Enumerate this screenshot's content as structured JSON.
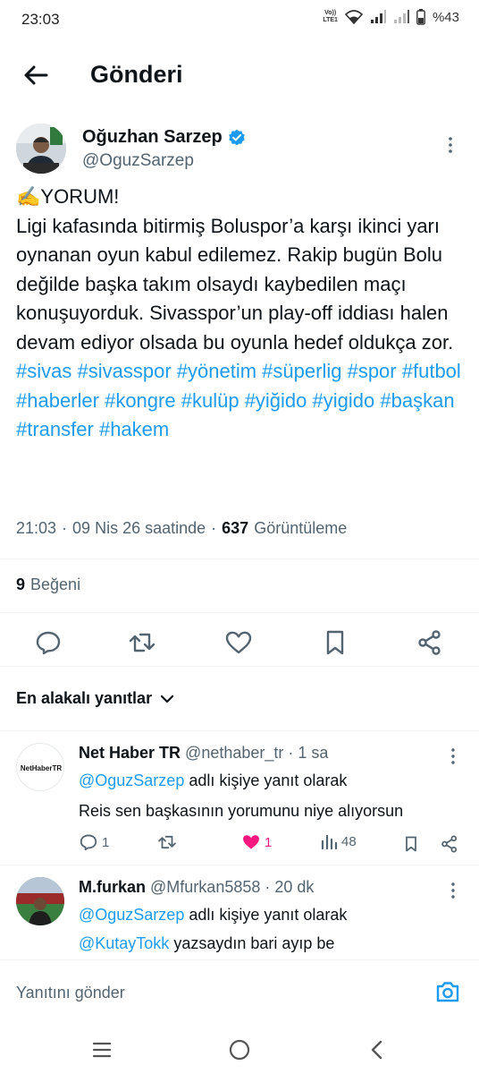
{
  "status_bar": {
    "time": "23:03",
    "volte": "Vo))\nLTE1",
    "battery": "%43"
  },
  "header": {
    "title": "Gönderi"
  },
  "tweet": {
    "author_name": "Oğuzhan Sarzep",
    "author_handle": "@OguzSarzep",
    "text_prefix": "✍️YORUM!\nLigi kafasında bitirmiş Boluspor’a karşı ikinci yarı oynanan oyun kabul edilemez. Rakip bugün Bolu değilde başka takım olsaydı kaybedilen maçı konuşuyorduk. Sivasspor’un play-off iddiası halen devam ediyor olsada bu oyunla hedef oldukça zor.",
    "hashtags": [
      "#sivas",
      "#sivasspor",
      "#yönetim",
      "#süperlig",
      "#spor",
      "#futbol",
      "#haberler",
      "#kongre",
      "#kulüp",
      "#yiğido",
      "#yigido",
      "#başkan",
      "#transfer",
      "#hakem"
    ],
    "time": "21:03",
    "date": "09 Nis 26 saatinde",
    "views_count": "637",
    "views_label": "Görüntüleme",
    "likes_count": "9",
    "likes_label": "Beğeni"
  },
  "sort_label": "En alakalı yanıtlar",
  "replies": [
    {
      "name": "Net Haber TR",
      "handle": "@nethaber_tr",
      "time": "· 1 sa",
      "avatar_text": "NetHaberTR",
      "reply_to_mention": "@OguzSarzep",
      "reply_to_suffix": "adlı kişiye yanıt olarak",
      "text": "Reis sen başkasının yorumunu niye alıyorsun",
      "replies_count": "1",
      "retweets_count": "",
      "likes_count": "1",
      "views_count": "48"
    },
    {
      "name": "M.furkan",
      "handle": "@Mfurkan5858",
      "time": "· 20 dk",
      "reply_to_mention": "@OguzSarzep",
      "reply_to_suffix": "adlı kişiye yanıt olarak",
      "text_mention": "@KutayTokk",
      "text": "yazsaydın bari ayıp be"
    }
  ],
  "composer": {
    "placeholder": "Yanıtını gönder"
  },
  "colors": {
    "accent": "#1d9bf0",
    "like_active": "#f91880",
    "text": "#0f1419",
    "muted": "#536471"
  }
}
